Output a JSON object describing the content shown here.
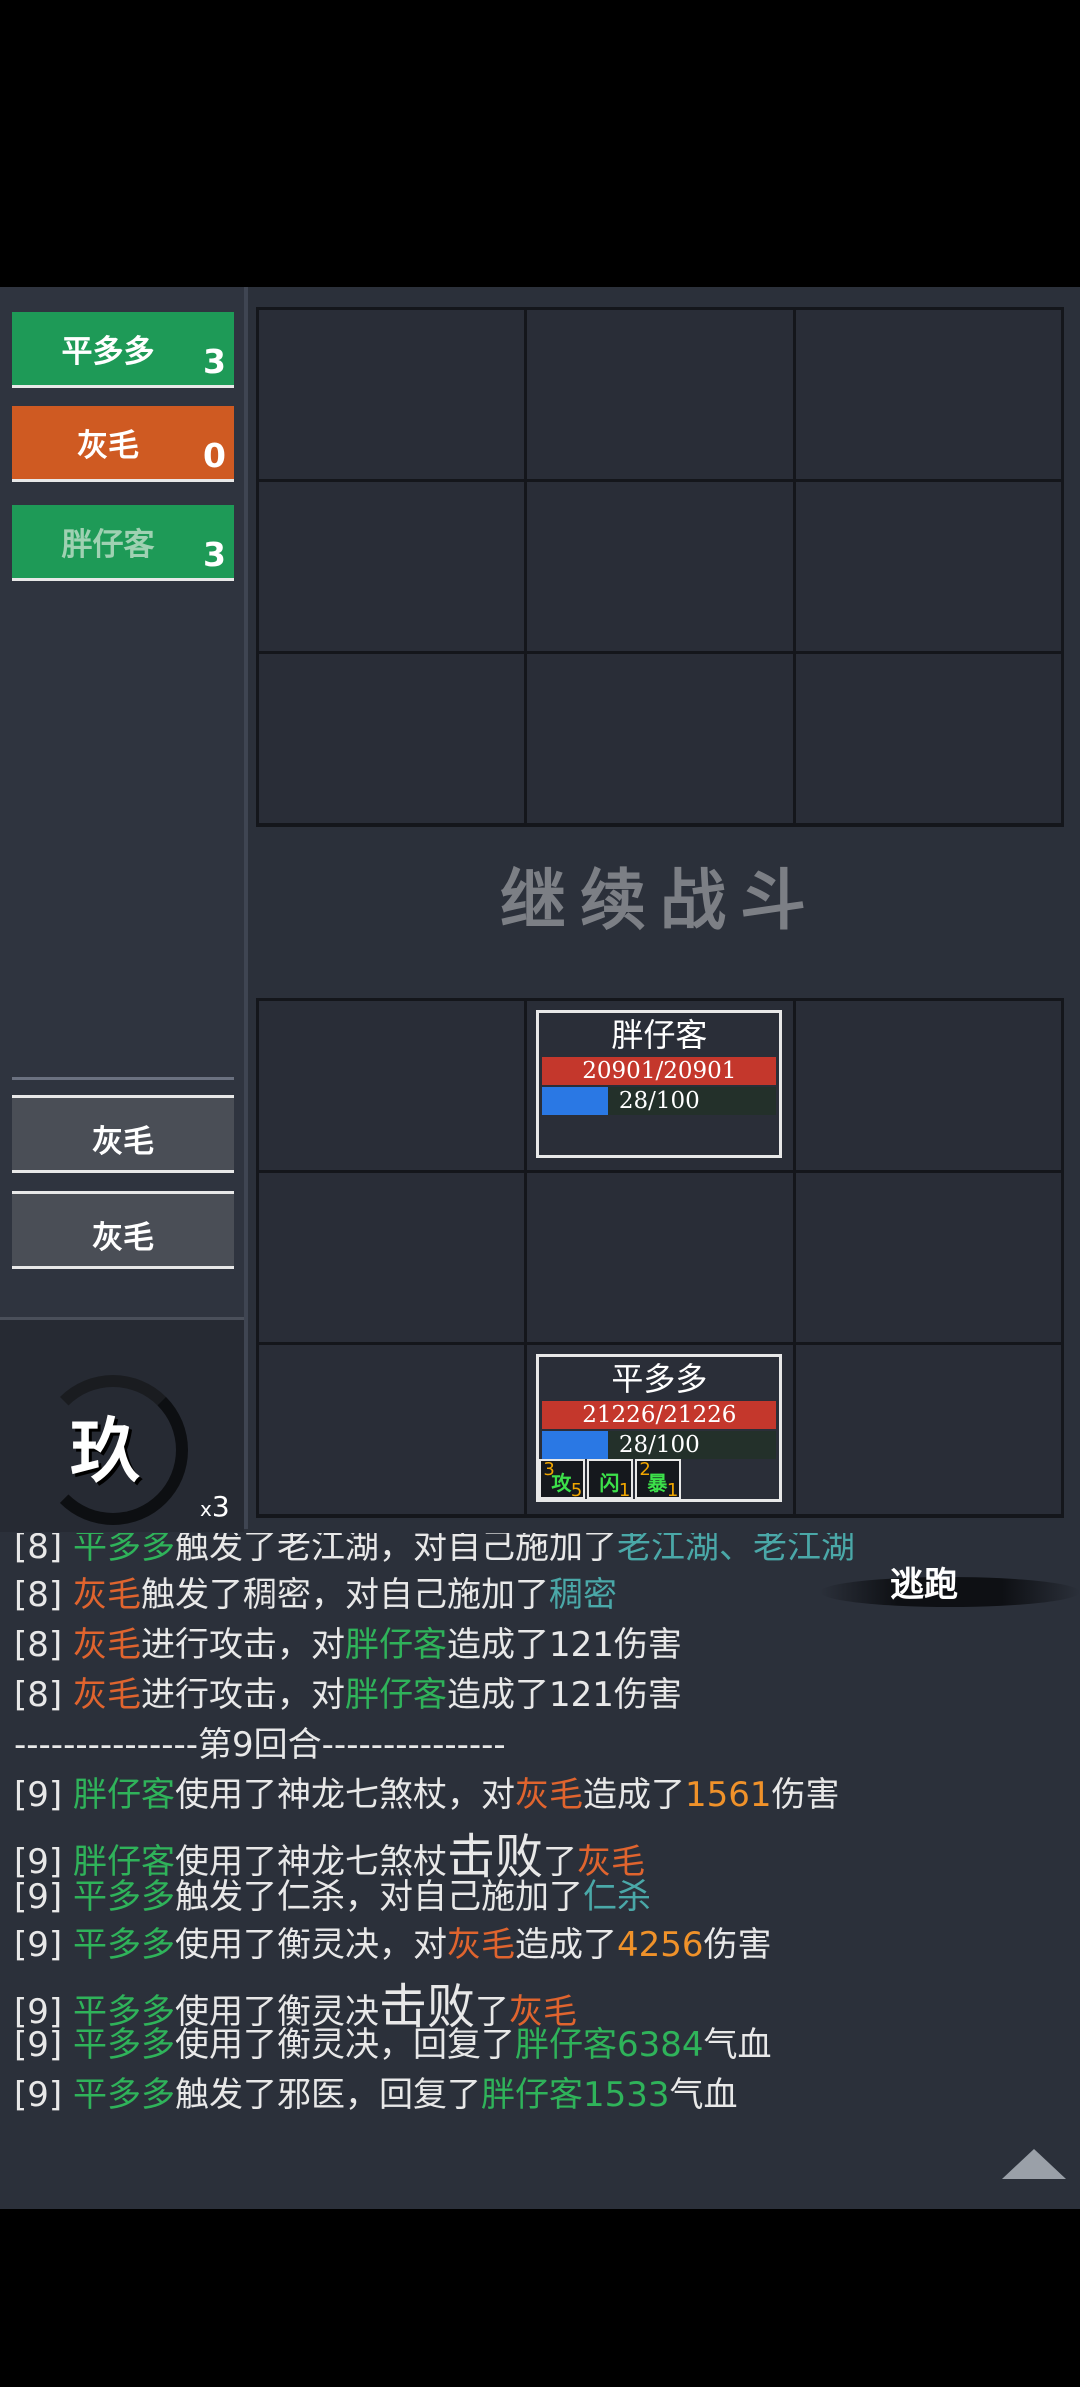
{
  "turn_order": [
    {
      "name": "平多多",
      "count": "3",
      "style": "green"
    },
    {
      "name": "灰毛",
      "count": "0",
      "style": "orange"
    },
    {
      "name": "胖仔客",
      "count": "3",
      "style": "green-dim"
    }
  ],
  "enemy_queue": [
    "灰毛",
    "灰毛"
  ],
  "round": {
    "char": "玖",
    "multiplier_prefix": "x",
    "multiplier": "3"
  },
  "continue_label": "继续战斗",
  "units": {
    "ally1": {
      "name": "胖仔客",
      "hp": "20901/20901",
      "mp": "28/100",
      "mp_fraction": 0.28
    },
    "hero": {
      "name": "平多多",
      "hp": "21226/21226",
      "mp": "28/100",
      "mp_fraction": 0.28,
      "buffs": [
        {
          "n": "3",
          "t": "攻",
          "c": "5"
        },
        {
          "n": "",
          "t": "闪",
          "c": "1"
        },
        {
          "n": "2",
          "t": "暴",
          "c": "1"
        }
      ]
    }
  },
  "flee_label": "逃跑",
  "log": [
    {
      "parts": [
        [
          "[8] ",
          ""
        ],
        [
          "平多多",
          "g"
        ],
        [
          "触发了老江湖，对自己施加了",
          ""
        ],
        [
          "老江湖、老江湖",
          "c"
        ]
      ]
    },
    {
      "parts": [
        [
          "[8] ",
          ""
        ],
        [
          "灰毛",
          "o"
        ],
        [
          "触发了稠密，对自己施加了",
          ""
        ],
        [
          "稠密",
          "c"
        ]
      ]
    },
    {
      "parts": [
        [
          "[8] ",
          ""
        ],
        [
          "灰毛",
          "o"
        ],
        [
          "进行攻击，对",
          ""
        ],
        [
          "胖仔客",
          "g"
        ],
        [
          "造成了121伤害",
          ""
        ]
      ]
    },
    {
      "parts": [
        [
          "[8] ",
          ""
        ],
        [
          "灰毛",
          "o"
        ],
        [
          "进行攻击，对",
          ""
        ],
        [
          "胖仔客",
          "g"
        ],
        [
          "造成了121伤害",
          ""
        ]
      ]
    },
    {
      "parts": [
        [
          "---------------第9回合---------------",
          ""
        ]
      ]
    },
    {
      "parts": [
        [
          "[9] ",
          ""
        ],
        [
          "胖仔客",
          "g"
        ],
        [
          "使用了神龙七煞杖，对",
          ""
        ],
        [
          "灰毛",
          "o"
        ],
        [
          "造成了",
          ""
        ],
        [
          "1561",
          "y"
        ],
        [
          "伤害",
          ""
        ]
      ]
    },
    {
      "parts": [
        [
          "[9] ",
          ""
        ],
        [
          "胖仔客",
          "g"
        ],
        [
          "使用了神龙七煞杖",
          ""
        ],
        [
          "击败",
          "big"
        ],
        [
          "了",
          ""
        ],
        [
          "灰毛",
          "o"
        ]
      ]
    },
    {
      "parts": [
        [
          "[9] ",
          ""
        ],
        [
          "平多多",
          "g"
        ],
        [
          "触发了仁杀，对自己施加了",
          ""
        ],
        [
          "仁杀",
          "c"
        ]
      ]
    },
    {
      "parts": [
        [
          "[9] ",
          ""
        ],
        [
          "平多多",
          "g"
        ],
        [
          "使用了衡灵决，对",
          ""
        ],
        [
          "灰毛",
          "o"
        ],
        [
          "造成了",
          ""
        ],
        [
          "4256",
          "y"
        ],
        [
          "伤害",
          ""
        ]
      ]
    },
    {
      "parts": [
        [
          "[9] ",
          ""
        ],
        [
          "平多多",
          "g"
        ],
        [
          "使用了衡灵决",
          ""
        ],
        [
          "击败",
          "big"
        ],
        [
          "了",
          ""
        ],
        [
          "灰毛",
          "o"
        ]
      ]
    },
    {
      "parts": [
        [
          "[9] ",
          ""
        ],
        [
          "平多多",
          "g"
        ],
        [
          "使用了衡灵决，回复了",
          ""
        ],
        [
          "胖仔客6384",
          "g"
        ],
        [
          "气血",
          ""
        ]
      ]
    },
    {
      "parts": [
        [
          "[9] ",
          ""
        ],
        [
          "平多多",
          "g"
        ],
        [
          "触发了邪医，回复了",
          ""
        ],
        [
          "胖仔客1533",
          "g"
        ],
        [
          "气血",
          ""
        ]
      ]
    }
  ]
}
